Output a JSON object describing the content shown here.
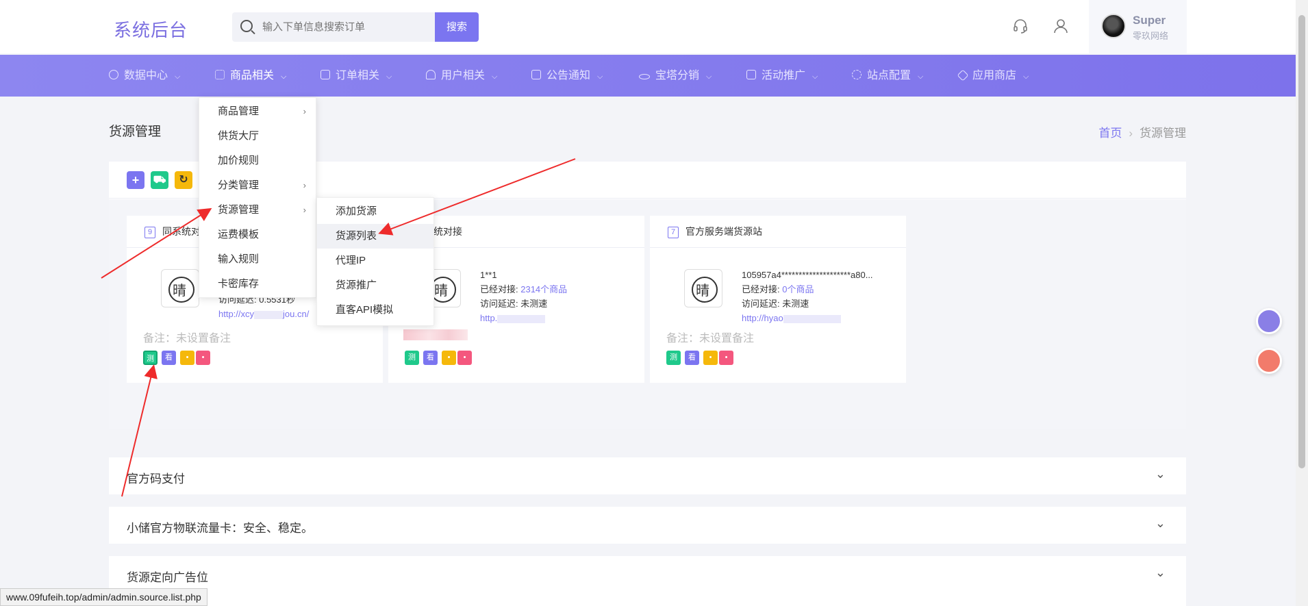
{
  "header": {
    "brand": "系统后台",
    "search_placeholder": "输入下单信息搜索订单",
    "search_button": "搜索",
    "user_name": "Super",
    "user_subtitle": "零玖网络"
  },
  "nav": {
    "items": [
      {
        "label": "数据中心"
      },
      {
        "label": "商品相关"
      },
      {
        "label": "订单相关"
      },
      {
        "label": "用户相关"
      },
      {
        "label": "公告通知"
      },
      {
        "label": "宝塔分销"
      },
      {
        "label": "活动推广"
      },
      {
        "label": "站点配置"
      },
      {
        "label": "应用商店"
      }
    ]
  },
  "dropdown": {
    "items": [
      {
        "label": "商品管理",
        "has_sub": true
      },
      {
        "label": "供货大厅"
      },
      {
        "label": "加价规则"
      },
      {
        "label": "分类管理",
        "has_sub": true
      },
      {
        "label": "货源管理",
        "has_sub": true
      },
      {
        "label": "运费模板"
      },
      {
        "label": "输入规则"
      },
      {
        "label": "卡密库存"
      }
    ],
    "submenu": [
      {
        "label": "添加货源"
      },
      {
        "label": "货源列表"
      },
      {
        "label": "代理IP"
      },
      {
        "label": "货源推广"
      },
      {
        "label": "直客API模拟"
      }
    ]
  },
  "page": {
    "title": "货源管理",
    "breadcrumb_home": "首页",
    "breadcrumb_current": "货源管理"
  },
  "cards": [
    {
      "num": "9",
      "title": "同系统对",
      "info_line": "访问延迟: 0.5531秒",
      "link": "http://xcy",
      "link_tail": "jou.cn/",
      "note": "备注：未设置备注"
    },
    {
      "num": "",
      "title": "系统对接",
      "account": "1**1",
      "connected_label": "已经对接: ",
      "connected_value": "2314个商品",
      "latency": "访问延迟: 未测速",
      "link": "http."
    },
    {
      "num": "7",
      "title": "官方服务端货源站",
      "account": "105957a4********************a80...",
      "connected_label": "已经对接: ",
      "connected_value": "0个商品",
      "latency": "访问延迟: 未测速",
      "link": "http://hyao",
      "note": "备注：未设置备注"
    }
  ],
  "card_buttons": {
    "test": "测",
    "view": "看"
  },
  "accordions": [
    {
      "title": "官方码支付"
    },
    {
      "title": "小储官方物联流量卡：安全、稳定。"
    },
    {
      "title": "货源定向广告位"
    }
  ],
  "status_url": "www.09fufeih.top/admin/admin.source.list.php",
  "colors": {
    "accent": "#7b75f0",
    "green": "#1fc98b",
    "yellow": "#f5b80b",
    "pink": "#f4577e",
    "arrow": "#ee2b2b"
  }
}
